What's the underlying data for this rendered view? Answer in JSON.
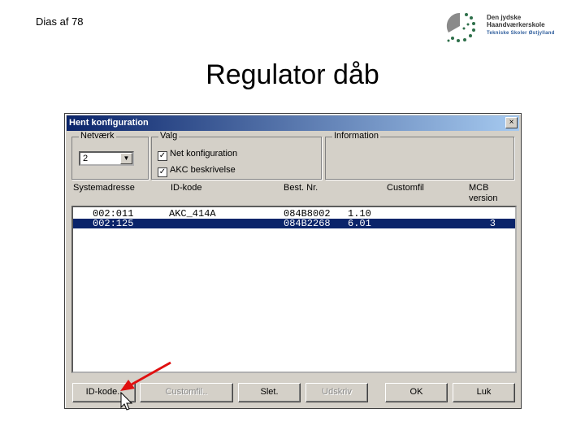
{
  "slide": {
    "counter": "Dias  af 78",
    "title": "Regulator dåb"
  },
  "logo": {
    "line1": "Den jydske",
    "line2": "Haandværkerskole",
    "line3": "Tekniske Skoler Østjylland"
  },
  "dialog": {
    "title": "Hent konfiguration",
    "close_label": "×",
    "network": {
      "label": "Netværk",
      "selected": "2"
    },
    "options": {
      "label": "Valg",
      "items": [
        {
          "label": "Net konfiguration",
          "checked": true,
          "mark": "✓"
        },
        {
          "label": "AKC beskrivelse",
          "checked": true,
          "mark": "✓"
        }
      ]
    },
    "information": {
      "label": "Information"
    },
    "columns": [
      "Systemadresse",
      "ID-kode",
      "Best. Nr.",
      "Customfil",
      "MCB\nversion"
    ],
    "rows": [
      {
        "address": "002:011",
        "id_code": "AKC_414A",
        "order_no": "084B8002",
        "version": "1.10",
        "mcb": "",
        "selected": false
      },
      {
        "address": "002:125",
        "id_code": "",
        "order_no": "084B2268",
        "version": "6.01",
        "mcb": "3",
        "selected": true
      }
    ],
    "buttons": [
      {
        "label": "ID-kode..",
        "enabled": true
      },
      {
        "label": "Customfil..",
        "enabled": false
      },
      {
        "label": "Slet.",
        "enabled": true
      },
      {
        "label": "Udskriv",
        "enabled": false
      },
      {
        "label": "OK",
        "enabled": true
      },
      {
        "label": "Luk",
        "enabled": true
      }
    ]
  },
  "colors": {
    "titlebar_start": "#0a246a",
    "titlebar_end": "#a6caf0",
    "selection": "#0a246a",
    "dialog_face": "#d4d0c8",
    "annotation_arrow": "#e01010"
  }
}
